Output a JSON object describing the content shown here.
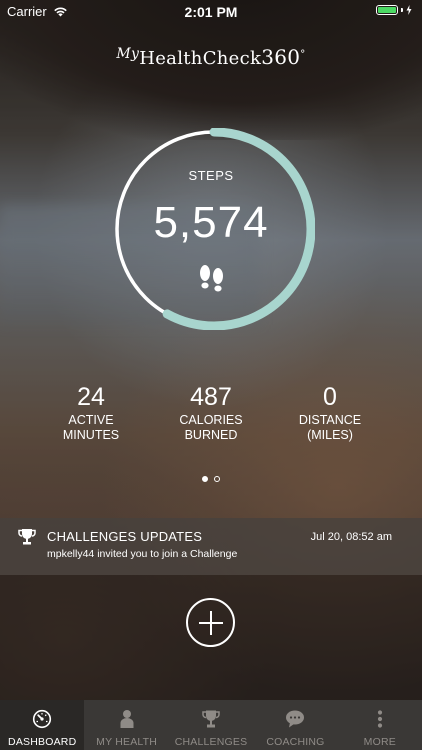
{
  "status_bar": {
    "carrier": "Carrier",
    "time": "2:01 PM",
    "battery_level": 1.0
  },
  "logo": {
    "my": "My",
    "brand": "HealthCheck",
    "number": "360",
    "degree": "°"
  },
  "steps": {
    "label": "STEPS",
    "value": "5,574",
    "ring_progress": 0.58,
    "ring_color": "#a8d5ce"
  },
  "stats": [
    {
      "value": "24",
      "label_line1": "ACTIVE",
      "label_line2": "MINUTES"
    },
    {
      "value": "487",
      "label_line1": "CALORIES",
      "label_line2": "BURNED"
    },
    {
      "value": "0",
      "label_line1": "DISTANCE",
      "label_line2": "(MILES)"
    }
  ],
  "pager": {
    "pages": 2,
    "active": 0
  },
  "challenges_card": {
    "title": "CHALLENGES UPDATES",
    "date": "Jul 20, 08:52 am",
    "message": "mpkelly44 invited you to join a Challenge"
  },
  "tabs": [
    {
      "label": "DASHBOARD",
      "icon": "speedometer-icon",
      "active": true
    },
    {
      "label": "MY HEALTH",
      "icon": "person-icon",
      "active": false
    },
    {
      "label": "CHALLENGES",
      "icon": "trophy-icon",
      "active": false
    },
    {
      "label": "COACHING",
      "icon": "chat-bubble-icon",
      "active": false
    },
    {
      "label": "MORE",
      "icon": "more-vertical-icon",
      "active": false
    }
  ]
}
